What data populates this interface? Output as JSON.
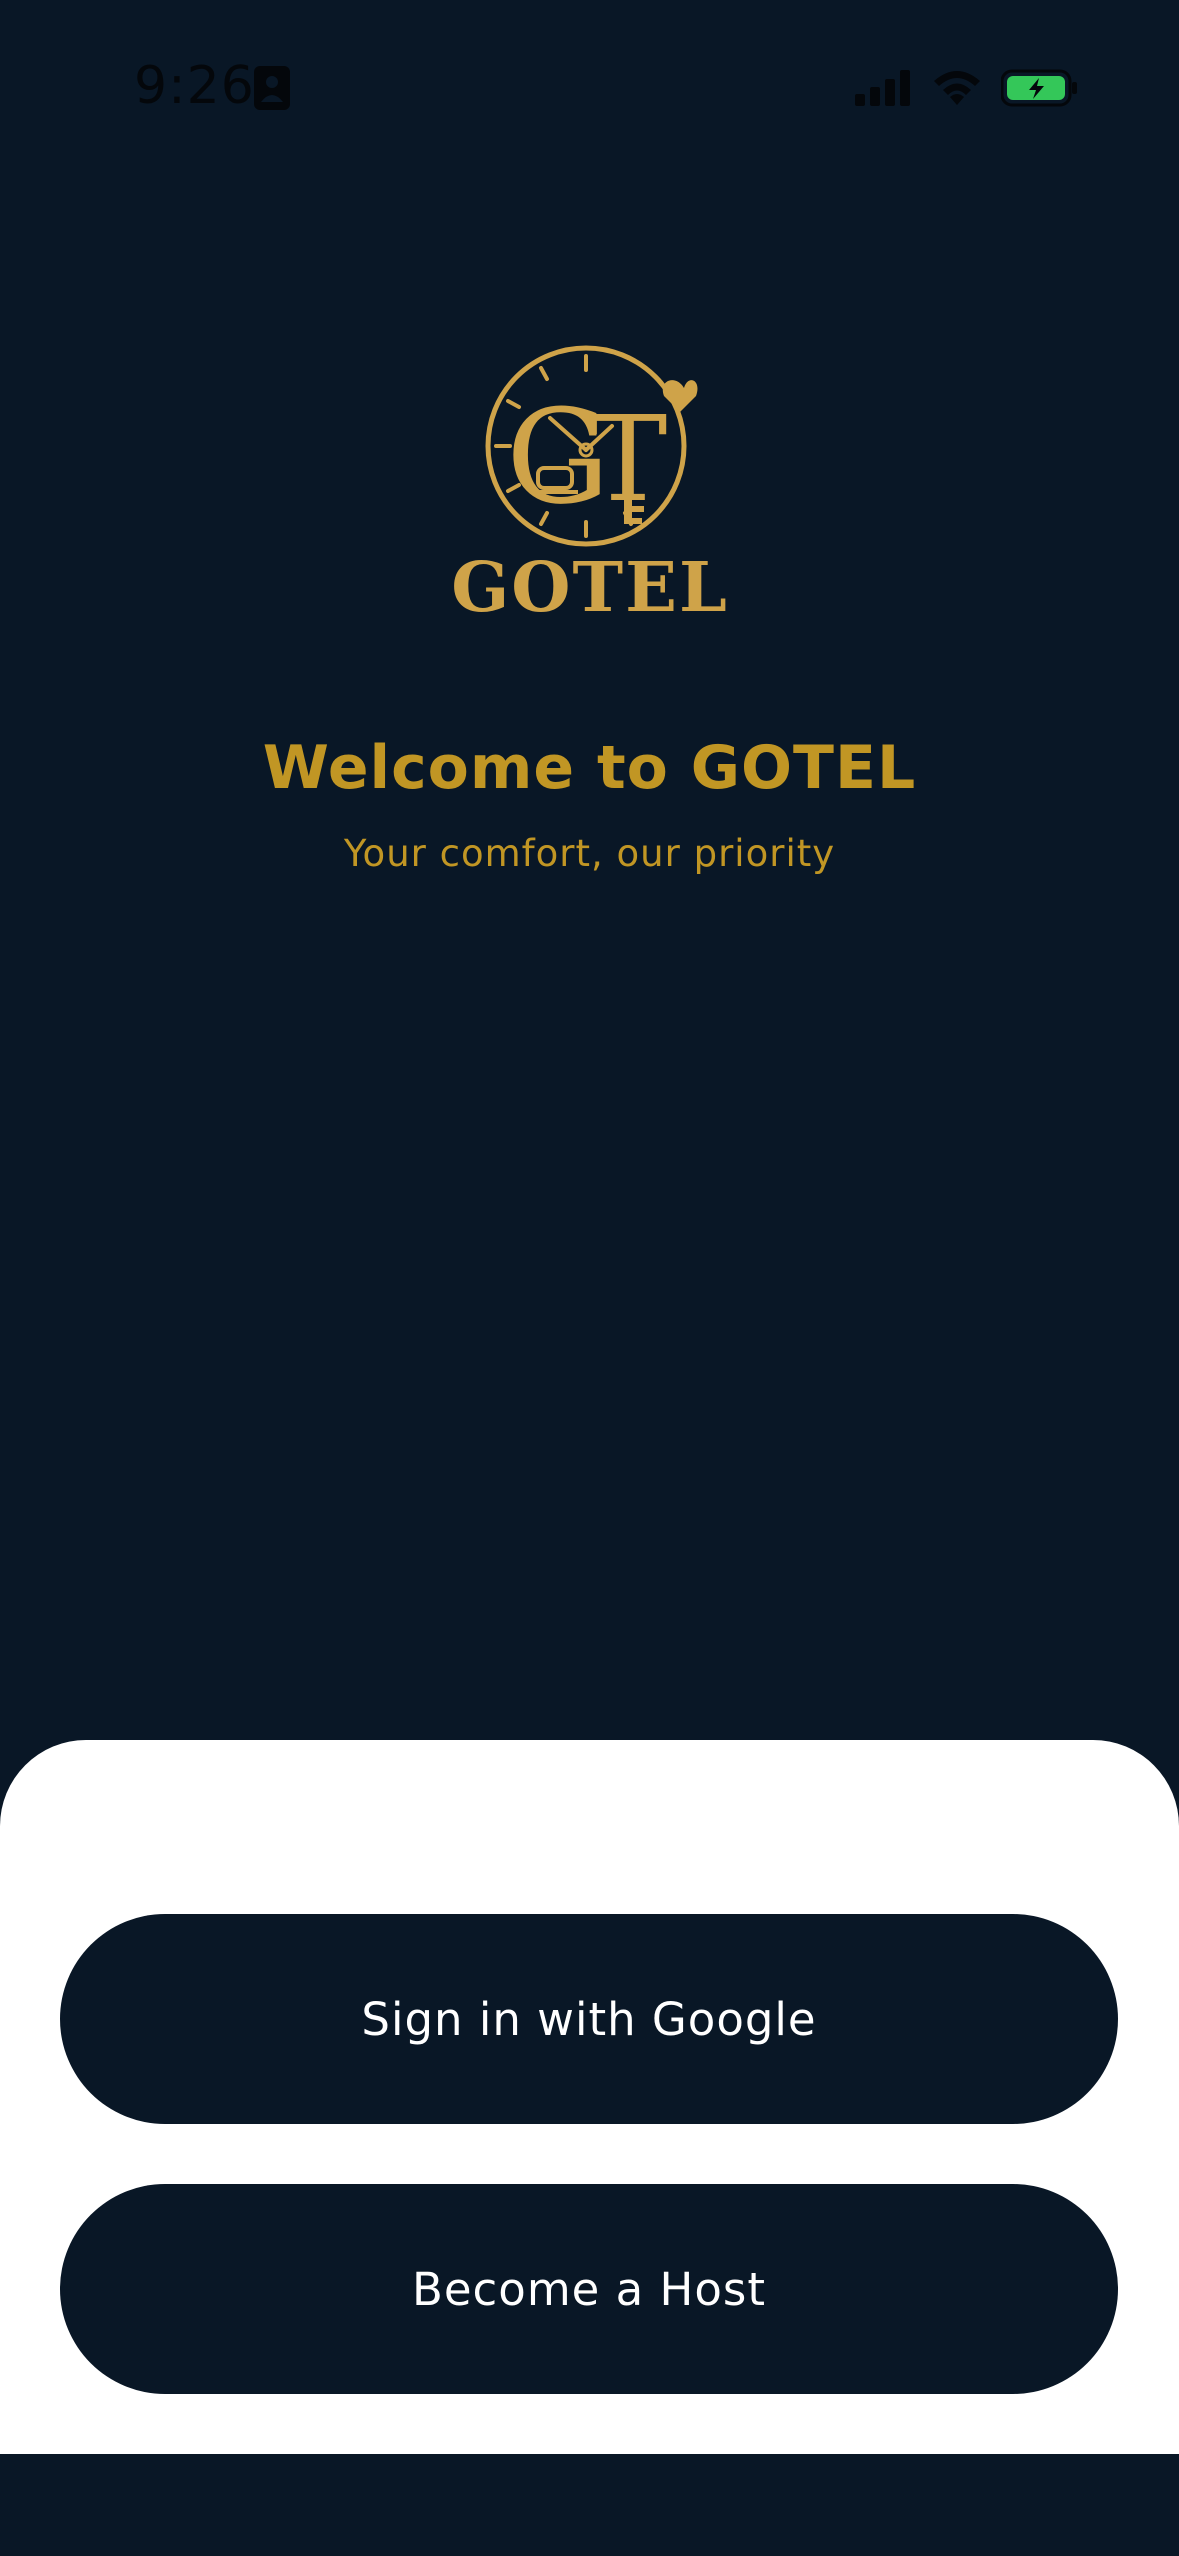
{
  "status_bar": {
    "time": "9:26",
    "icons": [
      "person-badge-icon",
      "cellular-signal-icon",
      "wifi-icon",
      "battery-charging-icon"
    ],
    "battery_color": "#34c759"
  },
  "logo": {
    "monogram": "GT",
    "wordmark": "GOTEL",
    "color": "#cfa349"
  },
  "welcome": {
    "title": "Welcome to GOTEL",
    "subtitle": "Your comfort, our priority",
    "color": "#c19624"
  },
  "actions": {
    "google_label": "Sign in with Google",
    "host_label": "Become a Host"
  },
  "colors": {
    "background": "#091726",
    "sheet": "#ffffff",
    "button": "#091726",
    "button_text": "#ffffff"
  }
}
